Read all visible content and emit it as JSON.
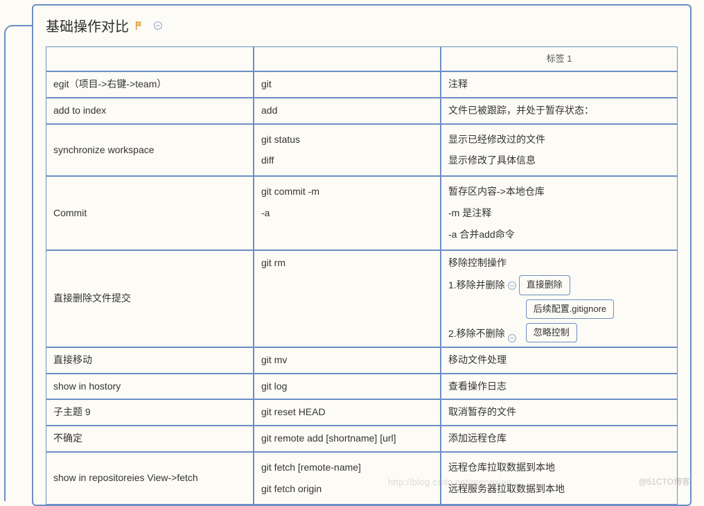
{
  "title": "基础操作对比",
  "header_label": "标签 1",
  "rows": [
    {
      "c1": "egit（项目->右键->team）",
      "c2": "git",
      "c3": "注释"
    },
    {
      "c1": "add to index",
      "c2": "add",
      "c3": "文件已被跟踪，并处于暂存状态："
    },
    {
      "c1": "synchronize workspace",
      "c2": "git status\ndiff",
      "c3": "显示已经修改过的文件\n显示修改了具体信息"
    },
    {
      "c1": "Commit",
      "c2": "git commit -m\n-a",
      "c3": "暂存区内容->本地仓库\n-m 是注释\n-a  合并add命令"
    },
    {
      "c1": "直接删除文件提交",
      "c2": "git rm",
      "c3_special": {
        "line0": "移除控制操作",
        "line1_prefix": "1.移除并删除",
        "line1_box": "直接删除",
        "line2_prefix": "2.移除不删除",
        "line2_box_top": "后续配置.gitignore",
        "line2_box": "忽略控制"
      }
    },
    {
      "c1": "直接移动",
      "c2": "git mv",
      "c3": "移动文件处理"
    },
    {
      "c1": "show in hostory",
      "c2": "git log",
      "c3": "查看操作日志"
    },
    {
      "c1": "子主题 9",
      "c2": "git reset HEAD",
      "c3": "取消暂存的文件"
    },
    {
      "c1": "不确定",
      "c2": "git remote add [shortname] [url]",
      "c3": "添加远程仓库"
    },
    {
      "c1": "show in repositoreies View->fetch",
      "c2": "git fetch [remote-name]\ngit fetch origin",
      "c3": "远程仓库拉取数据到本地\n远程服务器拉取数据到本地"
    }
  ],
  "watermark_right": "@51CTO博客",
  "watermark_left": "http://blog.csdn.net/mengxian..."
}
